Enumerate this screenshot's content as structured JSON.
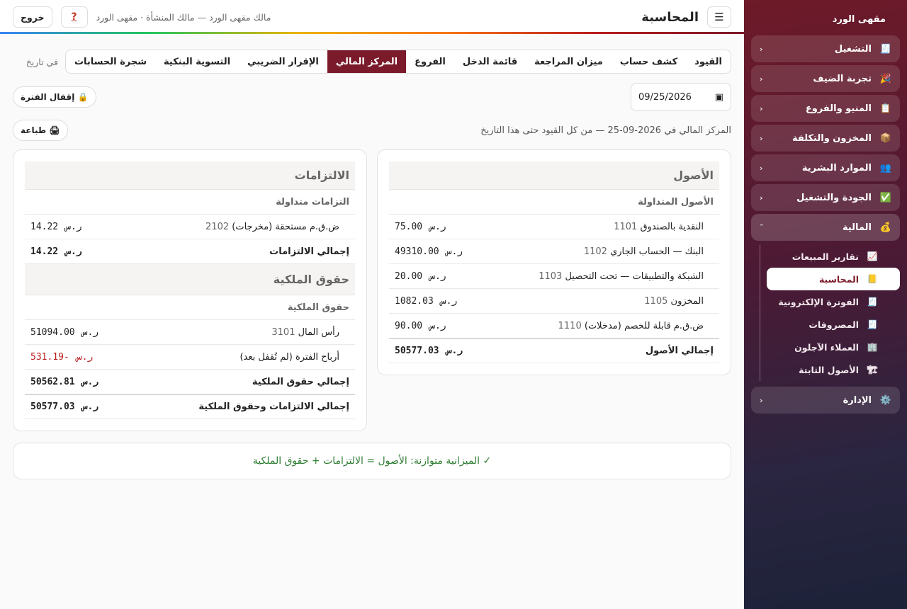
{
  "sidebar": {
    "brand": "مقهى الورد",
    "items": [
      {
        "label": "التشغيل",
        "icon": "🧾"
      },
      {
        "label": "تجربة الضيف",
        "icon": "🎉"
      },
      {
        "label": "المنيو والفروع",
        "icon": "📋"
      },
      {
        "label": "المخزون والتكلفة",
        "icon": "📦"
      },
      {
        "label": "الموارد البشرية",
        "icon": "👥"
      },
      {
        "label": "الجودة والتشغيل",
        "icon": "✅"
      },
      {
        "label": "المالية",
        "icon": "💰"
      }
    ],
    "finance_sub": [
      {
        "label": "تقارير المبيعات",
        "icon": "📈"
      },
      {
        "label": "المحاسبة",
        "icon": "📒"
      },
      {
        "label": "الفوترة الإلكترونية",
        "icon": "🧾"
      },
      {
        "label": "المصروفات",
        "icon": "🧾"
      },
      {
        "label": "العملاء الآجلون",
        "icon": "🏢"
      },
      {
        "label": "الأصول الثابتة",
        "icon": "🏗"
      }
    ],
    "admin": {
      "label": "الإدارة",
      "icon": "⚙️"
    },
    "chev_closed": "‹",
    "chev_open": "ˆ"
  },
  "topbar": {
    "menu_icon": "☰",
    "title": "المحاسبة",
    "owner": "مالك مقهى الورد — مالك المنشأة · مقهى الورد",
    "help_icon": "?",
    "logout": "خروج"
  },
  "tabs": [
    {
      "label": "القيود",
      "active": false
    },
    {
      "label": "كشف حساب",
      "active": false
    },
    {
      "label": "ميزان المراجعة",
      "active": false
    },
    {
      "label": "قائمة الدخل",
      "active": false
    },
    {
      "label": "الفروع",
      "active": false
    },
    {
      "label": "المركز المالي",
      "active": true
    },
    {
      "label": "الإقرار الضريبي",
      "active": false
    },
    {
      "label": "التسوية البنكية",
      "active": false
    },
    {
      "label": "شجرة الحسابات",
      "active": false
    }
  ],
  "asof_label": "في تاريخ",
  "date_value": "09/25/2026",
  "calendar_icon": "▣",
  "close_period": "🔒 إقفال الفترة",
  "print": "🖨 طباعة",
  "description": "المركز المالي في 2026-09-25 — من كل القيود حتى هذا التاريخ",
  "currency": "ر.س",
  "assets": {
    "title": "الأصول",
    "sub": "الأصول المتداولة",
    "rows": [
      {
        "name": "النقدية بالصندوق",
        "code": "1101",
        "amount": "75.00"
      },
      {
        "name": "البنك — الحساب الجاري",
        "code": "1102",
        "amount": "49310.00"
      },
      {
        "name": "الشبكة والتطبيقات — تحت التحصيل",
        "code": "1103",
        "amount": "20.00"
      },
      {
        "name": "المخزون",
        "code": "1105",
        "amount": "1082.03"
      },
      {
        "name": "ض.ق.م قابلة للخصم (مدخلات)",
        "code": "1110",
        "amount": "90.00"
      }
    ],
    "total_label": "إجمالي الأصول",
    "total": "50577.03"
  },
  "liabilities": {
    "title": "الالتزامات",
    "sub": "التزامات متداولة",
    "rows": [
      {
        "name": "ض.ق.م مستحقة (مخرجات)",
        "code": "2102",
        "amount": "14.22"
      }
    ],
    "total_label": "إجمالي الالتزامات",
    "total": "14.22"
  },
  "equity": {
    "title": "حقوق الملكية",
    "sub": "حقوق الملكية",
    "capital_name": "رأس المال",
    "capital_code": "3101",
    "capital_amount": "51094.00",
    "profit_name": "أرباح الفترة (لم تُقفل بعد)",
    "profit_amount": "-531.19",
    "total_label": "إجمالي حقوق الملكية",
    "total": "50562.81",
    "grand_label": "إجمالي الالتزامات وحقوق الملكية",
    "grand_total": "50577.03"
  },
  "balance_msg": "✓ الميزانية متوازنة: الأصول = الالتزامات + حقوق الملكية"
}
